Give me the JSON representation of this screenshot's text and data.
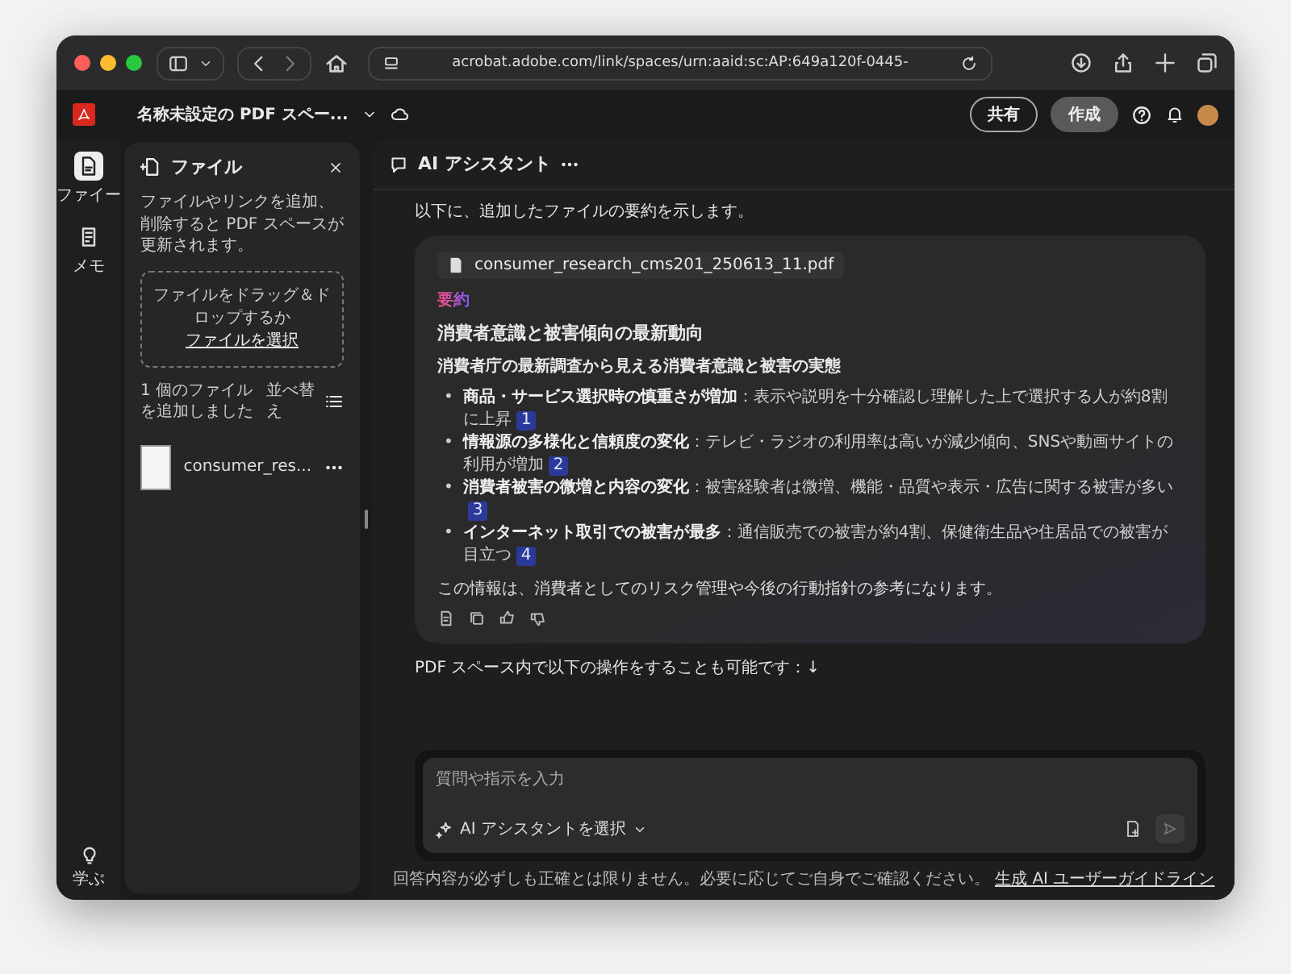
{
  "browser": {
    "url": "acrobat.adobe.com/link/spaces/urn:aaid:sc:AP:649a120f-0445-"
  },
  "app_header": {
    "title": "名称未設定の PDF スペー...",
    "share": "共有",
    "create": "作成"
  },
  "rail": {
    "items": [
      {
        "label": "ファイー",
        "selected": true
      },
      {
        "label": "メモ",
        "selected": false
      }
    ],
    "learn": "学ぶ"
  },
  "files_panel": {
    "title": "ファイル",
    "description": "ファイルやリンクを追加、削除すると PDF スペースが更新されます。",
    "dropzone": {
      "text": "ファイルをドラッグ＆ドロップするか",
      "link": "ファイルを選択"
    },
    "count": "1 個のファイルを追加しました",
    "sort": "並べ替え",
    "files": [
      {
        "name": "consumer_res..."
      }
    ]
  },
  "assistant": {
    "title": "AI アシスタント",
    "intro": "以下に、追加したファイルの要約を示します。",
    "card": {
      "file": "consumer_research_cms201_250613_11.pdf",
      "label": "要約",
      "heading": "消費者意識と被害傾向の最新動向",
      "subheading": "消費者庁の最新調査から見える消費者意識と被害の実態",
      "bullets": [
        {
          "marker": "•",
          "lead": "商品・サービス選択時の慎重さが増加",
          "text": "：表示や説明を十分確認し理解した上で選択する人が約8割に上昇",
          "ref": "1"
        },
        {
          "marker": "•",
          "lead": "情報源の多様化と信頼度の変化",
          "text": "：テレビ・ラジオの利用率は高いが減少傾向、SNSや動画サイトの利用が増加",
          "ref": "2"
        },
        {
          "marker": "•",
          "lead": "消費者被害の微増と内容の変化",
          "text": "：被害経験者は微増、機能・品質や表示・広告に関する被害が多い",
          "ref": "3"
        },
        {
          "marker": "•",
          "lead": "インターネット取引での被害が最多",
          "text": "：通信販売での被害が約4割、保健衛生品や住居品での被害が目立つ",
          "ref": "4"
        }
      ],
      "closing": "この情報は、消費者としてのリスク管理や今後の行動指針の参考になります。"
    },
    "followup": "PDF スペース内で以下の操作をすることも可能です：↓",
    "input": {
      "placeholder": "質問や指示を入力",
      "selector": "AI アシスタントを選択"
    },
    "disclaimer": "回答内容が必ずしも正確とは限りません。必要に応じてご自身でご確認ください。",
    "guide_link": "生成 AI ユーザーガイドライン"
  }
}
